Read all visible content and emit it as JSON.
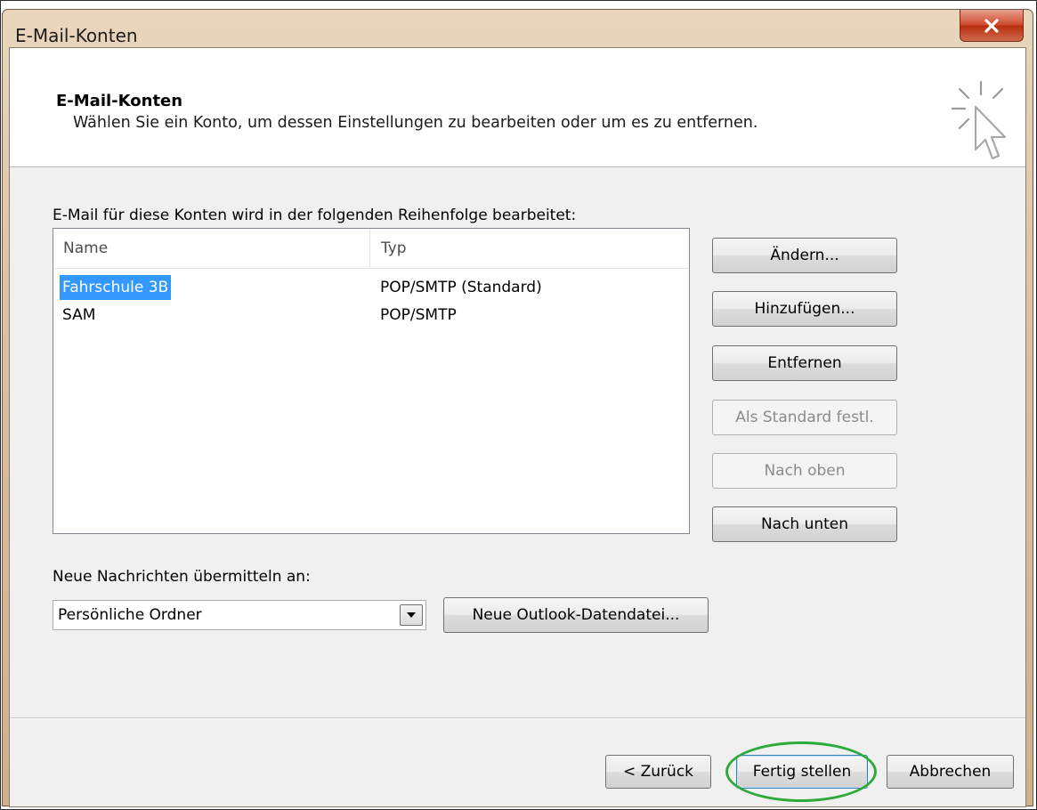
{
  "window": {
    "title": "E-Mail-Konten",
    "close_icon": "close-icon"
  },
  "header": {
    "title": "E-Mail-Konten",
    "subtitle": "Wählen Sie ein Konto, um dessen Einstellungen zu bearbeiten oder um es zu entfernen.",
    "icon": "cursor-click-icon"
  },
  "accounts": {
    "caption": "E-Mail für diese Konten wird in der folgenden Reihenfolge bearbeitet:",
    "columns": {
      "name": "Name",
      "type": "Typ"
    },
    "rows": [
      {
        "name": "Fahrschule 3B",
        "type": "POP/SMTP (Standard)",
        "selected": true
      },
      {
        "name": "SAM",
        "type": "POP/SMTP",
        "selected": false
      }
    ]
  },
  "side_buttons": {
    "change": "Ändern...",
    "add": "Hinzufügen...",
    "remove": "Entfernen",
    "set_default": "Als Standard festl.",
    "move_up": "Nach oben",
    "move_down": "Nach unten"
  },
  "delivery": {
    "label": "Neue Nachrichten übermitteln an:",
    "selected": "Persönliche Ordner",
    "new_file_button": "Neue Outlook-Datendatei..."
  },
  "footer": {
    "back": "< Zurück",
    "finish": "Fertig stellen",
    "cancel": "Abbrechen"
  },
  "colors": {
    "selection": "#3399ff",
    "highlight_ring": "#2eaa3c",
    "close_button": "#c8462b"
  }
}
